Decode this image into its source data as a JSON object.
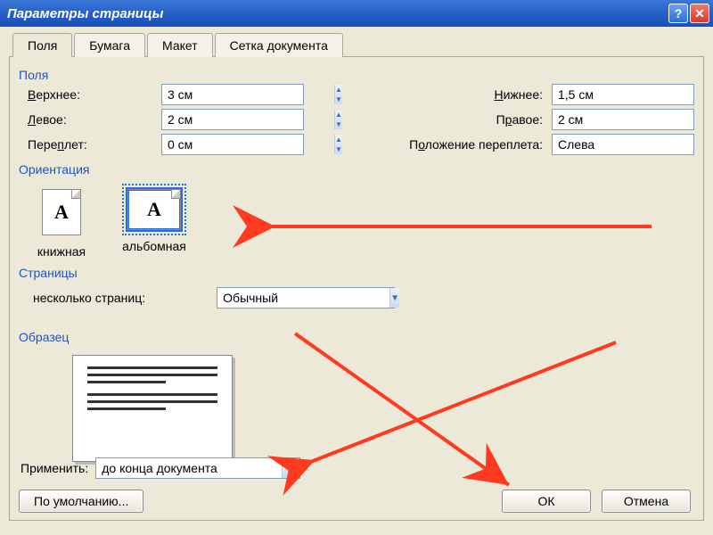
{
  "titlebar": {
    "title": "Параметры страницы"
  },
  "tabs": {
    "fields": "Поля",
    "paper": "Бумага",
    "layout": "Макет",
    "grid": "Сетка документа"
  },
  "groups": {
    "margins": "Поля",
    "orientation": "Ориентация",
    "pages": "Страницы",
    "preview": "Образец"
  },
  "margins": {
    "top_label": "Верхнее:",
    "top_value": "3 см",
    "bottom_label": "Нижнее:",
    "bottom_value": "1,5 см",
    "left_label": "Левое:",
    "left_value": "2 см",
    "right_label": "Правое:",
    "right_value": "2 см",
    "gutter_label": "Переплет:",
    "gutter_value": "0 см",
    "gutter_pos_label": "Положение переплета:",
    "gutter_pos_value": "Слева"
  },
  "orientation": {
    "portrait": "книжная",
    "landscape": "альбомная"
  },
  "pages": {
    "label": "несколько страниц:",
    "value": "Обычный"
  },
  "apply": {
    "label": "Применить:",
    "value": "до конца документа"
  },
  "buttons": {
    "default": "По умолчанию...",
    "ok": "ОК",
    "cancel": "Отмена"
  }
}
